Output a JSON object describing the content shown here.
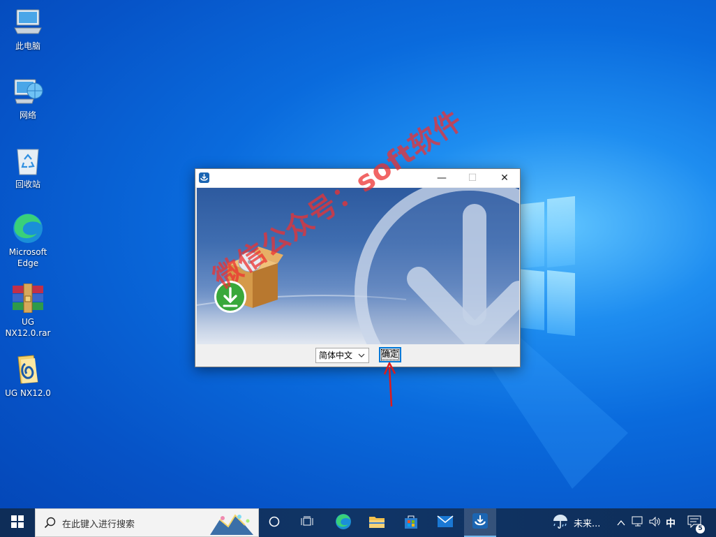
{
  "desktop": {
    "icons": [
      {
        "label": "此电脑",
        "icon": "computer-icon"
      },
      {
        "label": "网络",
        "icon": "network-icon"
      },
      {
        "label": "回收站",
        "icon": "recycle-bin-icon"
      },
      {
        "label": "Microsoft Edge",
        "icon": "edge-icon"
      },
      {
        "label": "UG NX12.0.rar",
        "icon": "winrar-archive-icon"
      },
      {
        "label": "UG NX12.0",
        "icon": "folder-icon"
      }
    ]
  },
  "dialog": {
    "window_controls": {
      "minimize": "—",
      "maximize": "☐",
      "close": "✕"
    },
    "language_select": {
      "value": "简体中文"
    },
    "confirm_label": "确定"
  },
  "watermark": "微信公众号：soft软件",
  "taskbar": {
    "search_placeholder": "在此键入进行搜索",
    "weather_text": "未来...",
    "ime": "中",
    "notification_count": "5"
  },
  "colors": {
    "accent": "#0078d7",
    "annotation_arrow": "#e01a1a",
    "taskbar": "#0e2d58",
    "desktop_blue": "#0a6bdd"
  }
}
